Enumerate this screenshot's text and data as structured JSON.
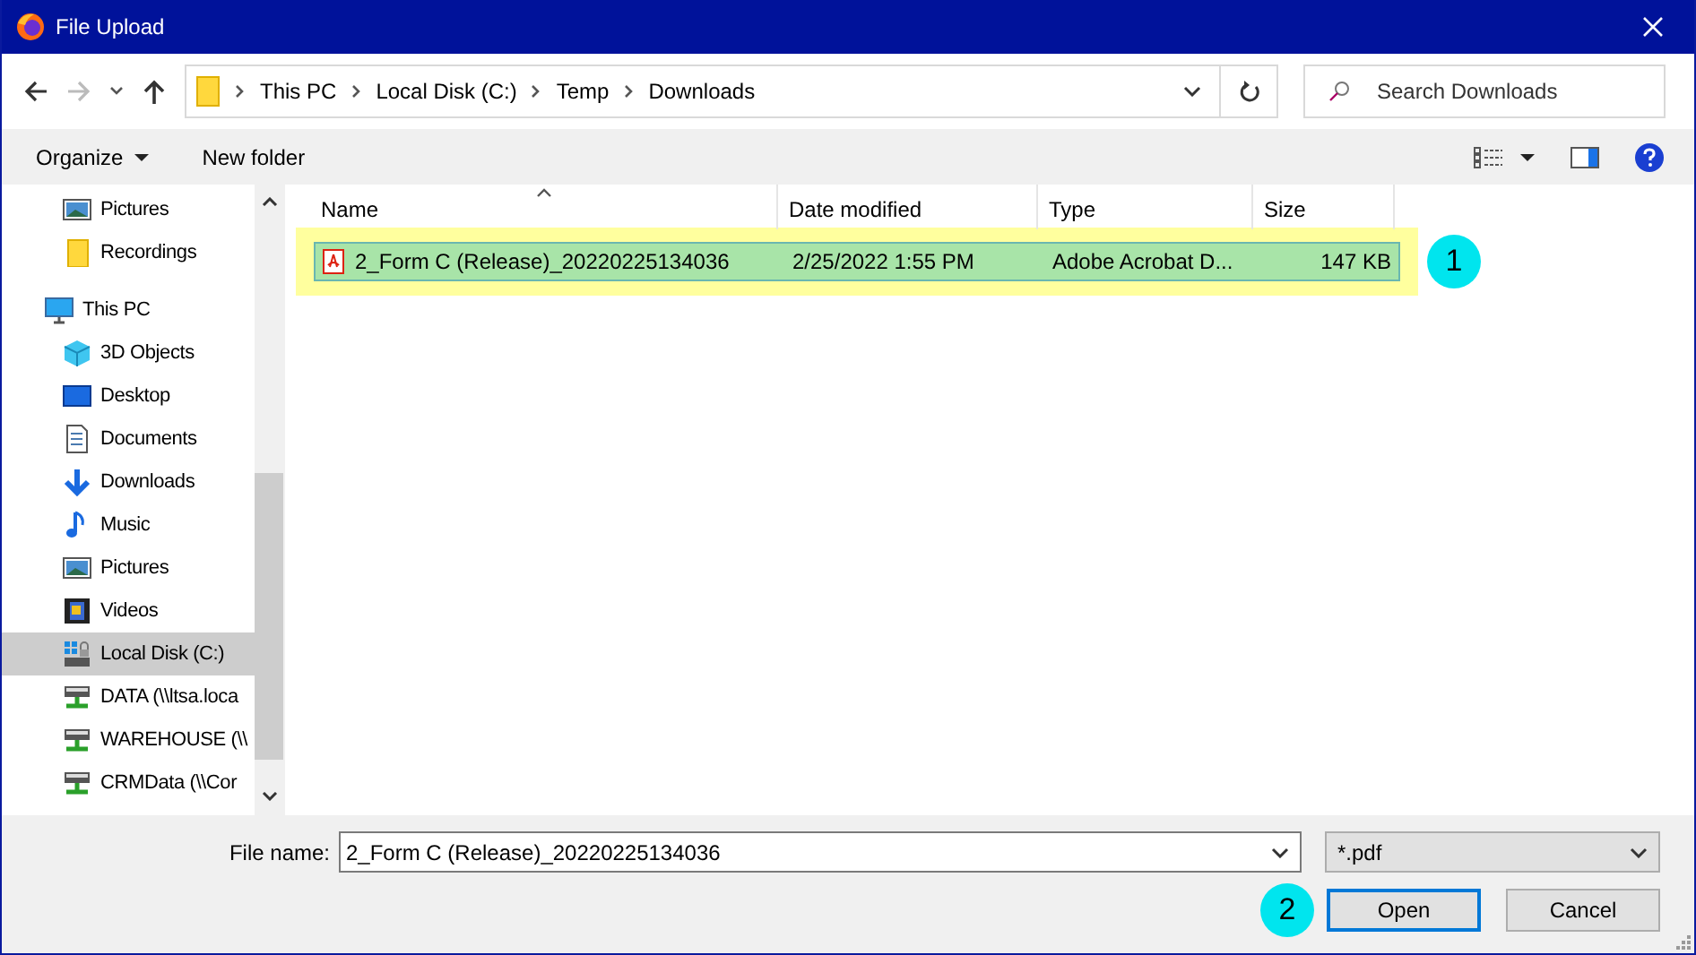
{
  "window": {
    "title": "File Upload"
  },
  "address": {
    "segments": [
      "This PC",
      "Local Disk (C:)",
      "Temp",
      "Downloads"
    ]
  },
  "search": {
    "placeholder": "Search Downloads"
  },
  "toolbar": {
    "organize": "Organize",
    "new_folder": "New folder"
  },
  "sidebar": {
    "sections": [
      {
        "items": [
          {
            "label": "Pictures",
            "kind": "picture",
            "selected": false
          },
          {
            "label": "Recordings",
            "kind": "folder",
            "selected": false
          }
        ]
      },
      {
        "label": "This PC",
        "kind": "pc",
        "selected": false,
        "items": [
          {
            "label": "3D Objects",
            "kind": "cube",
            "selected": false
          },
          {
            "label": "Desktop",
            "kind": "desktop",
            "selected": false
          },
          {
            "label": "Documents",
            "kind": "document",
            "selected": false
          },
          {
            "label": "Downloads",
            "kind": "download",
            "selected": false
          },
          {
            "label": "Music",
            "kind": "music",
            "selected": false
          },
          {
            "label": "Pictures",
            "kind": "picture",
            "selected": false
          },
          {
            "label": "Videos",
            "kind": "video",
            "selected": false
          },
          {
            "label": "Local Disk (C:)",
            "kind": "drive",
            "selected": true
          },
          {
            "label": "DATA (\\\\ltsa.loca",
            "kind": "network",
            "selected": false
          },
          {
            "label": "WAREHOUSE (\\\\",
            "kind": "network",
            "selected": false
          },
          {
            "label": "CRMData (\\\\Cor",
            "kind": "network",
            "selected": false
          }
        ]
      }
    ]
  },
  "file_list": {
    "columns": [
      "Name",
      "Date modified",
      "Type",
      "Size"
    ],
    "rows": [
      {
        "cells": [
          "2_Form C (Release)_20220225134036",
          "2/25/2022 1:55 PM",
          "Adobe Acrobat D...",
          "147 KB"
        ],
        "selected": true,
        "highlighted": true,
        "callout": "1"
      }
    ]
  },
  "bottom": {
    "file_name_label": "File name:",
    "file_name": "2_Form C (Release)_20220225134036",
    "filter": "*.pdf",
    "buttons": [
      {
        "label": "Open",
        "default": true,
        "callout": "2"
      },
      {
        "label": "Cancel",
        "default": false
      }
    ]
  }
}
